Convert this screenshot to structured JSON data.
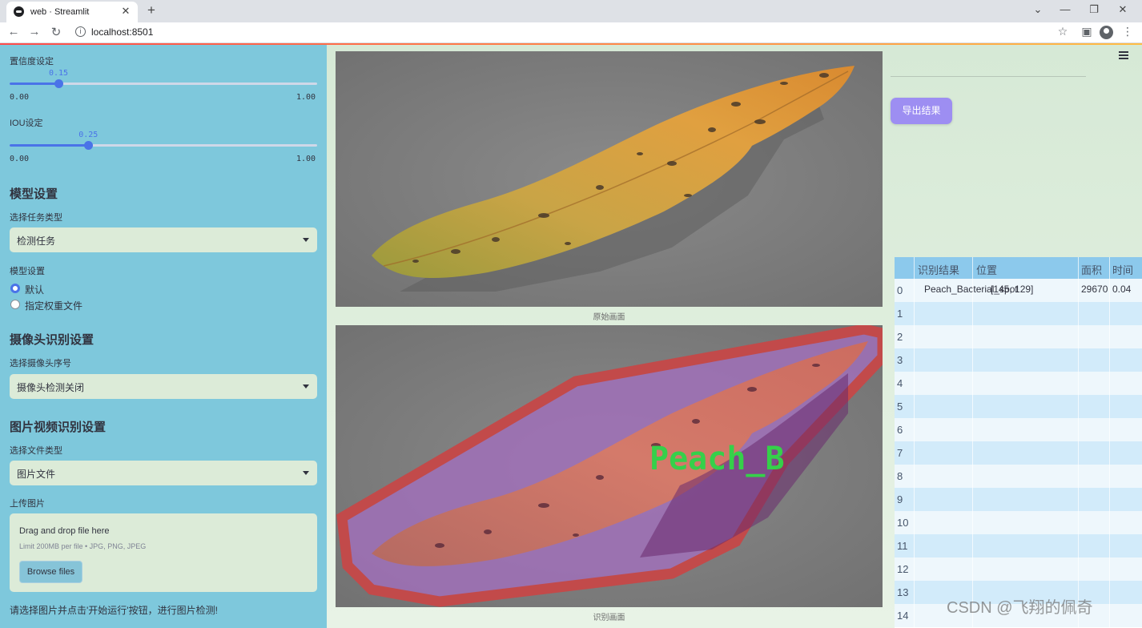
{
  "browser": {
    "tab_title": "web · Streamlit",
    "tab_close": "✕",
    "new_tab": "+",
    "url": "localhost:8501",
    "window_minimize": "—",
    "window_restore": "❐",
    "window_close": "✕",
    "back": "←",
    "forward": "→",
    "reload": "↻",
    "info": "i",
    "star": "☆",
    "sidepanel": "▣",
    "more": "⋮"
  },
  "sidebar": {
    "confidence": {
      "label": "置信度设定",
      "value": "0.15",
      "min": "0.00",
      "max": "1.00",
      "fraction": 0.15
    },
    "iou": {
      "label": "IOU设定",
      "value": "0.25",
      "min": "0.00",
      "max": "1.00",
      "fraction": 0.25
    },
    "model_section_title": "模型设置",
    "task_type": {
      "label": "选择任务类型",
      "selected": "检测任务"
    },
    "model_setting": {
      "label": "模型设置",
      "options": [
        "默认",
        "指定权重文件"
      ],
      "selected_index": 0
    },
    "camera_section_title": "摄像头识别设置",
    "camera": {
      "label": "选择摄像头序号",
      "selected": "摄像头检测关闭"
    },
    "file_section_title": "图片视频识别设置",
    "file_type": {
      "label": "选择文件类型",
      "selected": "图片文件"
    },
    "upload": {
      "label": "上传图片",
      "dropzone_title": "Drag and drop file here",
      "limit_text": "Limit 200MB per file • JPG, PNG, JPEG",
      "browse_label": "Browse files"
    },
    "hint": "请选择图片并点击'开始运行'按钮，进行图片检测!"
  },
  "main": {
    "export_label": "导出结果",
    "original_caption": "原始画面",
    "result_caption": "识别画面",
    "detection_label": "Peach_B"
  },
  "table": {
    "columns": [
      "识别结果",
      "位置",
      "面积",
      "时间"
    ],
    "rows": [
      {
        "index": "0",
        "result": "Peach_Bacterial_spot",
        "position": "[145, 129]",
        "area": "29670",
        "time": "0.04"
      },
      {
        "index": "1"
      },
      {
        "index": "2"
      },
      {
        "index": "3"
      },
      {
        "index": "4"
      },
      {
        "index": "5"
      },
      {
        "index": "6"
      },
      {
        "index": "7"
      },
      {
        "index": "8"
      },
      {
        "index": "9"
      },
      {
        "index": "10"
      },
      {
        "index": "11"
      },
      {
        "index": "12"
      },
      {
        "index": "13"
      },
      {
        "index": "14"
      }
    ]
  },
  "watermark": "CSDN @飞翔的佩奇",
  "colors": {
    "sidebar_bg": "#7ec8dc",
    "main_bg": "#d6e9d6",
    "accent": "#4a73e8",
    "export_button": "#9d8ef2",
    "table_header": "#8cc9ec",
    "detection_box": "#c24a4a",
    "detection_text": "#35d04a"
  }
}
